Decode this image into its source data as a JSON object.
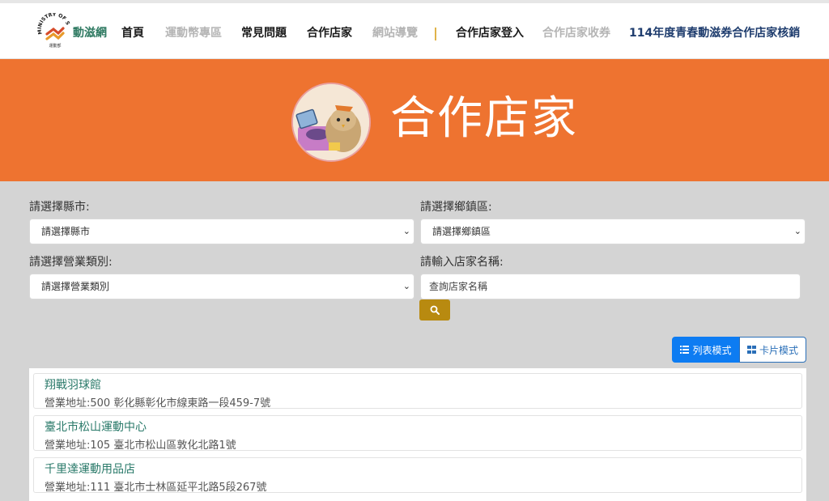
{
  "nav": {
    "logo_ring_text": "MINISTRY OF SPORTS",
    "logo_sub": "運動部",
    "brand": "動滋網",
    "items": [
      {
        "label": "首頁",
        "style": "normal"
      },
      {
        "label": "運動幣專區",
        "style": "muted"
      },
      {
        "label": "常見問題",
        "style": "normal"
      },
      {
        "label": "合作店家",
        "style": "normal"
      },
      {
        "label": "網站導覽",
        "style": "muted"
      },
      {
        "label": "合作店家登入",
        "style": "normal"
      },
      {
        "label": "合作店家收券",
        "style": "muted"
      },
      {
        "label": "114年度青春動滋券合作店家核銷",
        "style": "link"
      }
    ]
  },
  "banner": {
    "title": "合作店家"
  },
  "filters": {
    "county": {
      "label": "請選擇縣市:",
      "value": "請選擇縣市"
    },
    "district": {
      "label": "請選擇鄉鎮區:",
      "value": "請選擇鄉鎮區"
    },
    "category": {
      "label": "請選擇營業類別:",
      "value": "請選擇營業類別"
    },
    "name": {
      "label": "請輸入店家名稱:",
      "placeholder": "查詢店家名稱"
    }
  },
  "view_toggle": {
    "list_label": "列表模式",
    "card_label": "卡片模式",
    "active": "list"
  },
  "stores": [
    {
      "name": "翔戰羽球館",
      "address": "營業地址:500 彰化縣彰化市線東路一段459-7號"
    },
    {
      "name": "臺北市松山運動中心",
      "address": "營業地址:105 臺北市松山區敦化北路1號"
    },
    {
      "name": "千里達運動用品店",
      "address": "營業地址:111 臺北市士林區延平北路5段267號"
    }
  ],
  "colors": {
    "banner": "#ee7330",
    "primary": "#0d7cf2",
    "search": "#b88a10",
    "store_link": "#2a7a6a"
  }
}
